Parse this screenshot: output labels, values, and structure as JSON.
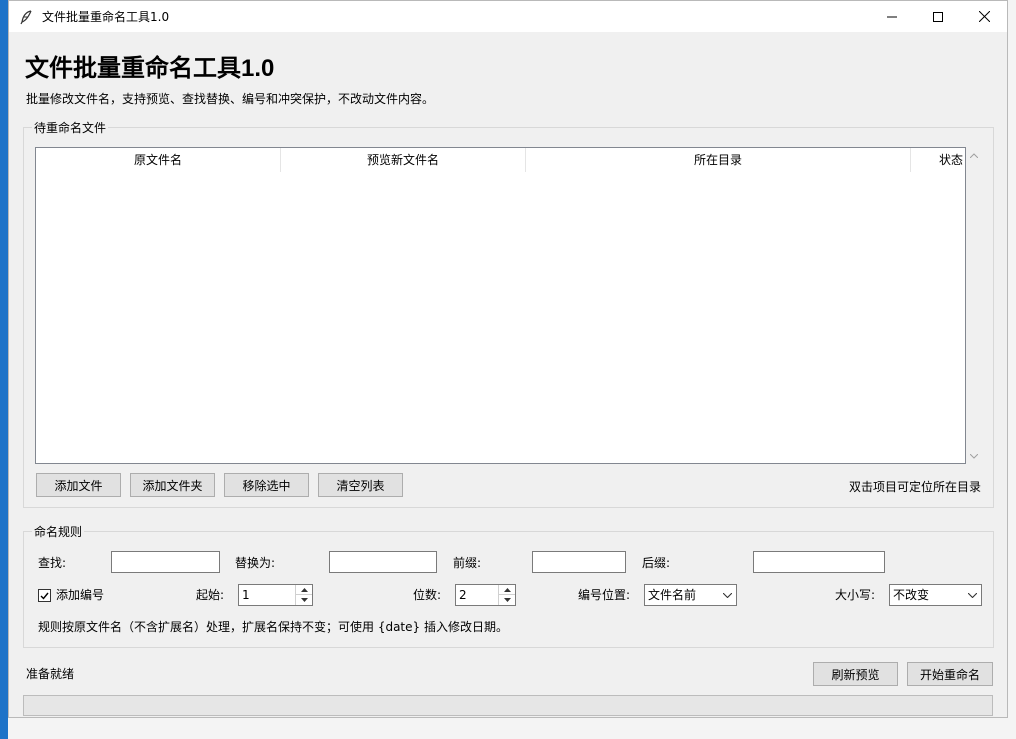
{
  "window": {
    "title": "文件批量重命名工具1.0"
  },
  "app": {
    "title": "文件批量重命名工具1.0",
    "subtitle": "批量修改文件名，支持预览、查找替换、编号和冲突保护，不改动文件内容。"
  },
  "files_group": {
    "legend": "待重命名文件",
    "columns": [
      "原文件名",
      "预览新文件名",
      "所在目录",
      "状态"
    ],
    "rows": [],
    "buttons": {
      "add_file": "添加文件",
      "add_folder": "添加文件夹",
      "remove_selected": "移除选中",
      "clear_list": "清空列表"
    },
    "hint": "双击项目可定位所在目录"
  },
  "rules_group": {
    "legend": "命名规则",
    "find_label": "查找:",
    "find_value": "",
    "replace_label": "替换为:",
    "replace_value": "",
    "prefix_label": "前缀:",
    "prefix_value": "",
    "suffix_label": "后缀:",
    "suffix_value": "",
    "add_number_label": "添加编号",
    "add_number_checked": true,
    "start_label": "起始:",
    "start_value": "1",
    "digits_label": "位数:",
    "digits_value": "2",
    "number_position_label": "编号位置:",
    "number_position_value": "文件名前",
    "case_label": "大小写:",
    "case_value": "不改变",
    "note": "规则按原文件名（不含扩展名）处理，扩展名保持不变；可使用 {date} 插入修改日期。"
  },
  "footer": {
    "status": "准备就绪",
    "refresh_button": "刷新预览",
    "start_button": "开始重命名",
    "progress": 0
  }
}
